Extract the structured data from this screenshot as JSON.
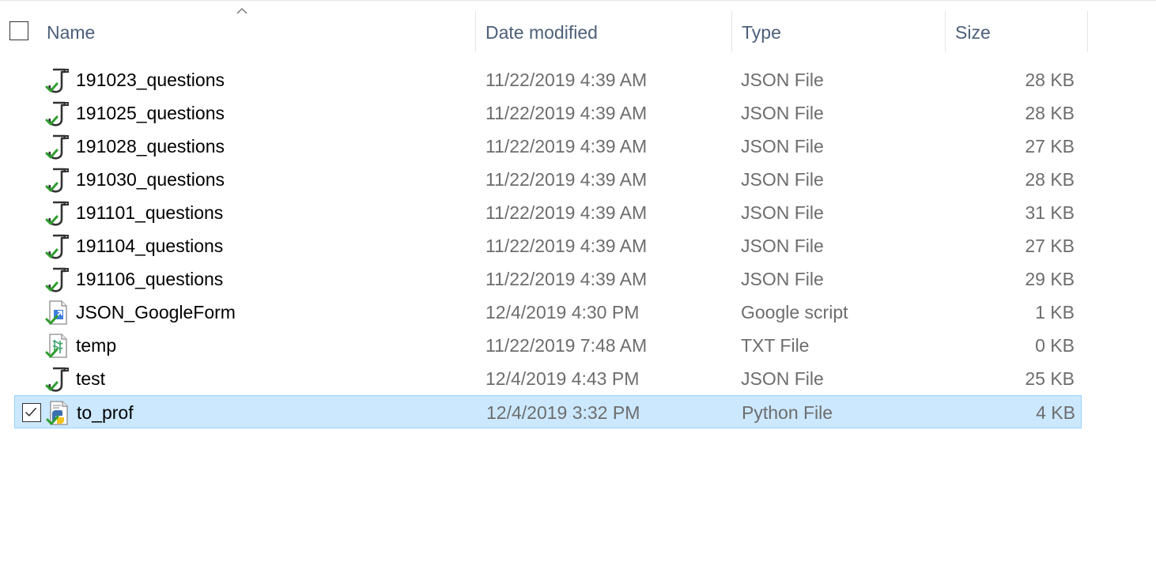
{
  "columns": {
    "name": "Name",
    "date": "Date modified",
    "type": "Type",
    "size": "Size"
  },
  "sort": {
    "column": "name",
    "direction": "ascending",
    "icon": "sort-up-arrow"
  },
  "files": [
    {
      "name": "191023_questions",
      "date": "11/22/2019 4:39 AM",
      "type": "JSON File",
      "size": "28 KB",
      "icon": "json-file-icon",
      "selected": false
    },
    {
      "name": "191025_questions",
      "date": "11/22/2019 4:39 AM",
      "type": "JSON File",
      "size": "28 KB",
      "icon": "json-file-icon",
      "selected": false
    },
    {
      "name": "191028_questions",
      "date": "11/22/2019 4:39 AM",
      "type": "JSON File",
      "size": "27 KB",
      "icon": "json-file-icon",
      "selected": false
    },
    {
      "name": "191030_questions",
      "date": "11/22/2019 4:39 AM",
      "type": "JSON File",
      "size": "28 KB",
      "icon": "json-file-icon",
      "selected": false
    },
    {
      "name": "191101_questions",
      "date": "11/22/2019 4:39 AM",
      "type": "JSON File",
      "size": "31 KB",
      "icon": "json-file-icon",
      "selected": false
    },
    {
      "name": "191104_questions",
      "date": "11/22/2019 4:39 AM",
      "type": "JSON File",
      "size": "27 KB",
      "icon": "json-file-icon",
      "selected": false
    },
    {
      "name": "191106_questions",
      "date": "11/22/2019 4:39 AM",
      "type": "JSON File",
      "size": "29 KB",
      "icon": "json-file-icon",
      "selected": false
    },
    {
      "name": "JSON_GoogleForm",
      "date": "12/4/2019 4:30 PM",
      "type": "Google script",
      "size": "1 KB",
      "icon": "google-script-file-icon",
      "selected": false
    },
    {
      "name": "temp",
      "date": "11/22/2019 7:48 AM",
      "type": "TXT File",
      "size": "0 KB",
      "icon": "txt-file-icon",
      "selected": false
    },
    {
      "name": "test",
      "date": "12/4/2019 4:43 PM",
      "type": "JSON File",
      "size": "25 KB",
      "icon": "json-file-icon",
      "selected": false
    },
    {
      "name": "to_prof",
      "date": "12/4/2019 3:32 PM",
      "type": "Python File",
      "size": "4 KB",
      "icon": "python-file-icon",
      "selected": true
    }
  ],
  "colors": {
    "header_text": "#4c607a",
    "secondary_text": "#6d6d6d",
    "selection_fill": "#cce8ff",
    "selection_border": "#99d1ff",
    "sync_check": "#2e9e2e"
  }
}
